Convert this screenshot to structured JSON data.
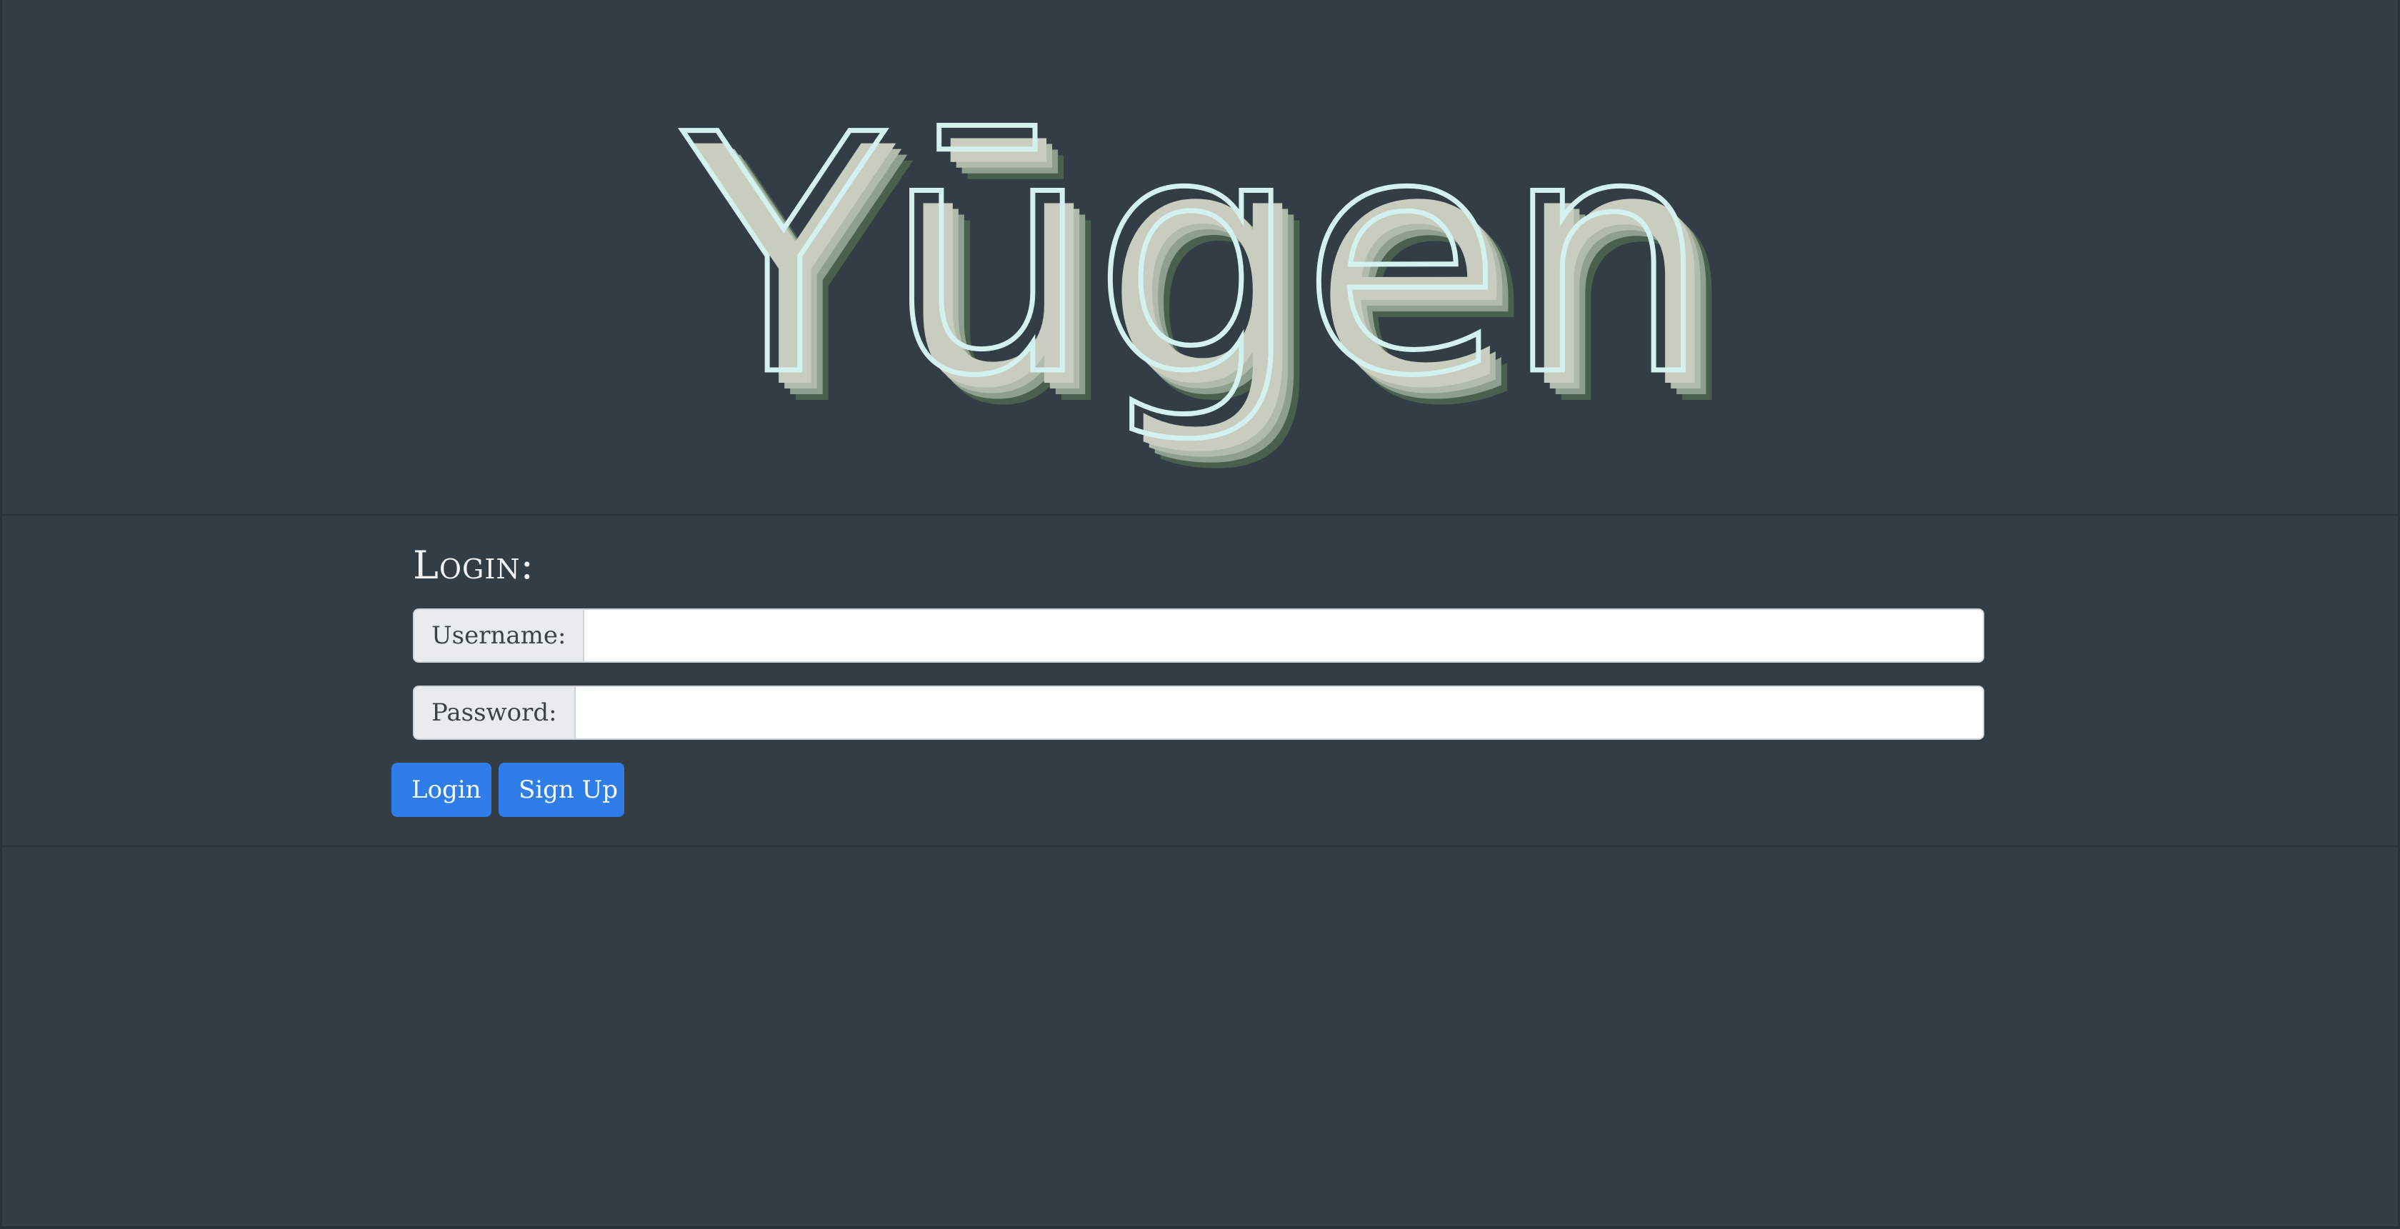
{
  "logo": {
    "text": "Yūgen",
    "colors": {
      "shadow_dark": "#49604f",
      "shadow_mid": "#8e9f8f",
      "fill": "#c9cdbf",
      "outline": "#d3f1ef"
    }
  },
  "login": {
    "heading": "Login:",
    "username_label": "Username:",
    "username_value": "",
    "password_label": "Password:",
    "password_value": "",
    "login_button": "Login",
    "signup_button": "Sign Up"
  },
  "theme": {
    "background": "#323d46",
    "button": "#2f7de8"
  }
}
